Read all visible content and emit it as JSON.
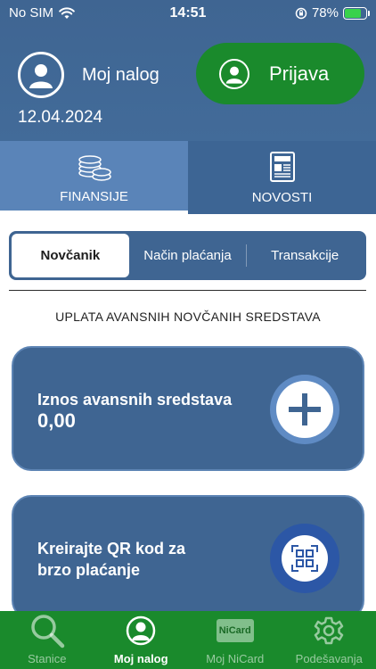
{
  "status_bar": {
    "carrier": "No SIM",
    "time": "14:51",
    "battery": "78%"
  },
  "header": {
    "account_label": "Moj nalog",
    "date": "12.04.2024",
    "login_label": "Prijava"
  },
  "main_tabs": [
    {
      "label": "FINANSIJE",
      "icon": "coins-icon",
      "active": true
    },
    {
      "label": "NOVOSTI",
      "icon": "newspaper-icon",
      "active": false
    }
  ],
  "segments": [
    {
      "label": "Novčanik",
      "active": true
    },
    {
      "label": "Način plaćanja",
      "active": false
    },
    {
      "label": "Transakcije",
      "active": false
    }
  ],
  "section_title": "UPLATA AVANSNIH NOVČANIH SREDSTAVA",
  "card_deposit": {
    "label": "Iznos avansnih sredstava",
    "value": "0,00",
    "icon": "plus-icon"
  },
  "card_qr": {
    "label_line1": "Kreirajte QR kod za",
    "label_line2": "brzo plaćanje",
    "icon": "qr-scan-icon"
  },
  "bottom_nav": [
    {
      "label": "Stanice",
      "icon": "search-icon",
      "active": false
    },
    {
      "label": "Moj nalog",
      "icon": "user-icon",
      "active": true
    },
    {
      "label": "Moj NiCard",
      "icon": "nicard-icon",
      "logo_text": "NiCard",
      "active": false
    },
    {
      "label": "Podešavanja",
      "icon": "gear-icon",
      "active": false
    }
  ],
  "colors": {
    "header": "#3f6592",
    "accent_green": "#1a8a2c",
    "tab_active": "#5a84b8",
    "card": "#3f6592"
  }
}
